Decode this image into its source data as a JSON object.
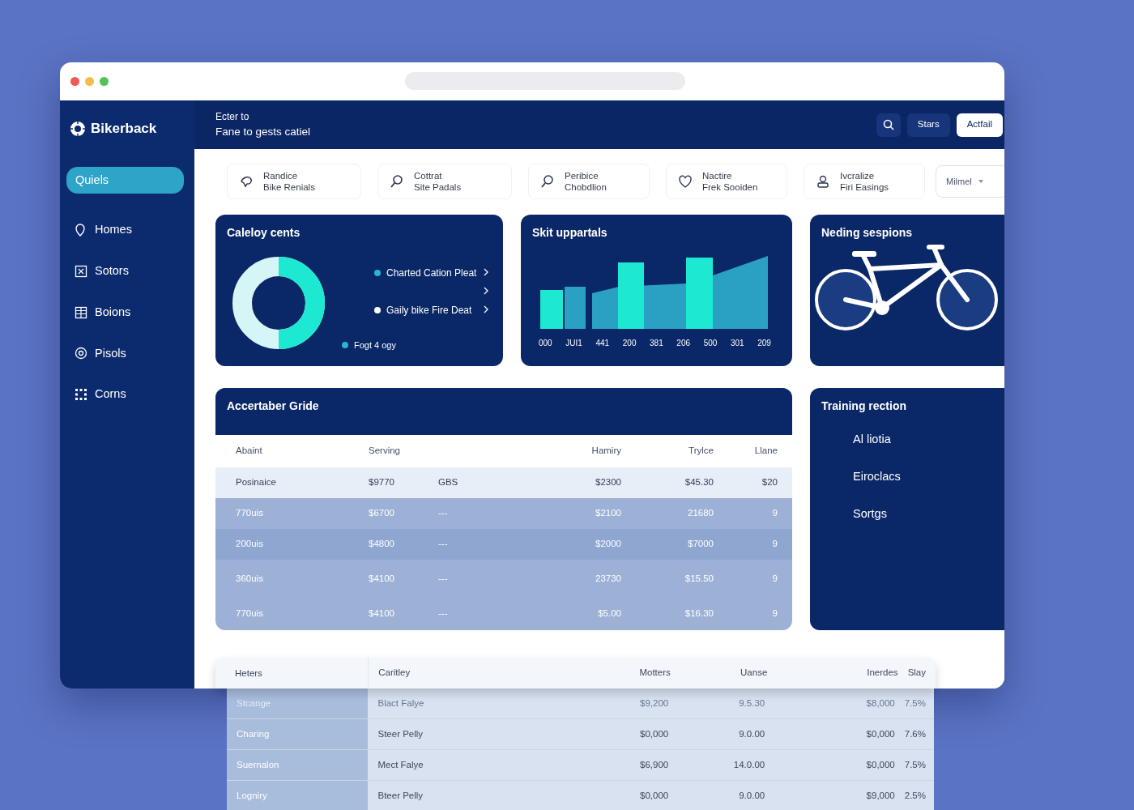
{
  "sidebar": {
    "brand": "Bikerback",
    "items": [
      {
        "label": "Quiels",
        "selected": true
      },
      {
        "label": "Homes",
        "selected": false
      },
      {
        "label": "Sotors",
        "selected": false
      },
      {
        "label": "Boions",
        "selected": false
      },
      {
        "label": "Pisols",
        "selected": false
      },
      {
        "label": "Corns",
        "selected": false
      }
    ]
  },
  "header": {
    "eyebrow": "Ecter to",
    "title": "Fane to gests catiel",
    "buttons": [
      {
        "kind": "search"
      },
      {
        "kind": "dark",
        "label": "Stars"
      },
      {
        "kind": "light",
        "label": "Actfail"
      }
    ]
  },
  "quick_links": [
    {
      "line1": "Randice",
      "line2": "Bike Renials"
    },
    {
      "line1": "Cottrat",
      "line2": "Site Padals"
    },
    {
      "line1": "Peribice",
      "line2": "Chobdlion"
    },
    {
      "line1": "Nactire",
      "line2": "Frek Sooiden"
    },
    {
      "line1": "Ivcralize",
      "line2": "Firi Easings"
    }
  ],
  "dropdown": {
    "label": "Milmel"
  },
  "donut_card": {
    "title": "Caleloy cents",
    "legend": [
      {
        "label": "Charted Cation Pleat",
        "color": "#2bb3d6"
      },
      {
        "label": "Gaily bike Fire Deat",
        "color": "#ffffff"
      },
      {
        "label": "Fogt 4 ogy",
        "color": "#2bb3d6"
      }
    ]
  },
  "bar_card": {
    "title": "Skit uppartals",
    "axis_labels": [
      "000",
      "JUI1",
      "441",
      "200",
      "381",
      "206",
      "500",
      "301",
      "209"
    ]
  },
  "bike_card": {
    "title": "Neding sespions"
  },
  "grid_table": {
    "title": "Accertaber Gride",
    "columns": [
      "Abaint",
      "Serving",
      "",
      "Hamiry",
      "Trylce",
      "Llane"
    ],
    "rows": [
      {
        "selected": true,
        "cells": [
          "Posinaice",
          "$9770",
          "GBS",
          "$2300",
          "$45.30",
          "$20"
        ]
      },
      {
        "selected": false,
        "cells": [
          "770uis",
          "$6700",
          "---",
          "$2100",
          "21680",
          "9"
        ]
      },
      {
        "selected": false,
        "cells": [
          "200uis",
          "$4800",
          "---",
          "$2000",
          "$7000",
          "9"
        ]
      },
      {
        "selected": false,
        "cells": [
          "360uis",
          "$4100",
          "---",
          "23730",
          "$15.50",
          "9"
        ]
      },
      {
        "selected": false,
        "cells": [
          "770uis",
          "$4100",
          "---",
          "$5.00",
          "$16.30",
          "9"
        ]
      }
    ]
  },
  "training": {
    "title": "Training rection",
    "items": [
      "Al liotia",
      "Eiroclacs",
      "Sortgs"
    ]
  },
  "lower_table": {
    "columns": [
      "Heters",
      "Caritley",
      "Motters",
      "Uanse",
      "Inerdes",
      "Slay"
    ],
    "rows": [
      {
        "disabled": true,
        "cells": [
          "Stcange",
          "Blact Falye",
          "$9,200",
          "9.5.30",
          "$8,000",
          "7.5%"
        ]
      },
      {
        "disabled": false,
        "cells": [
          "Charing",
          "Steer Pelly",
          "$0,000",
          "9.0.00",
          "$0,000",
          "7.6%"
        ]
      },
      {
        "disabled": false,
        "cells": [
          "Suernalon",
          "Mect Falye",
          "$6,900",
          "14.0.00",
          "$0,000",
          "7.5%"
        ]
      },
      {
        "disabled": false,
        "cells": [
          "Logniry",
          "Bteer Pelly",
          "$0,000",
          "9.0.00",
          "$9,000",
          "2.5%"
        ]
      }
    ]
  }
}
